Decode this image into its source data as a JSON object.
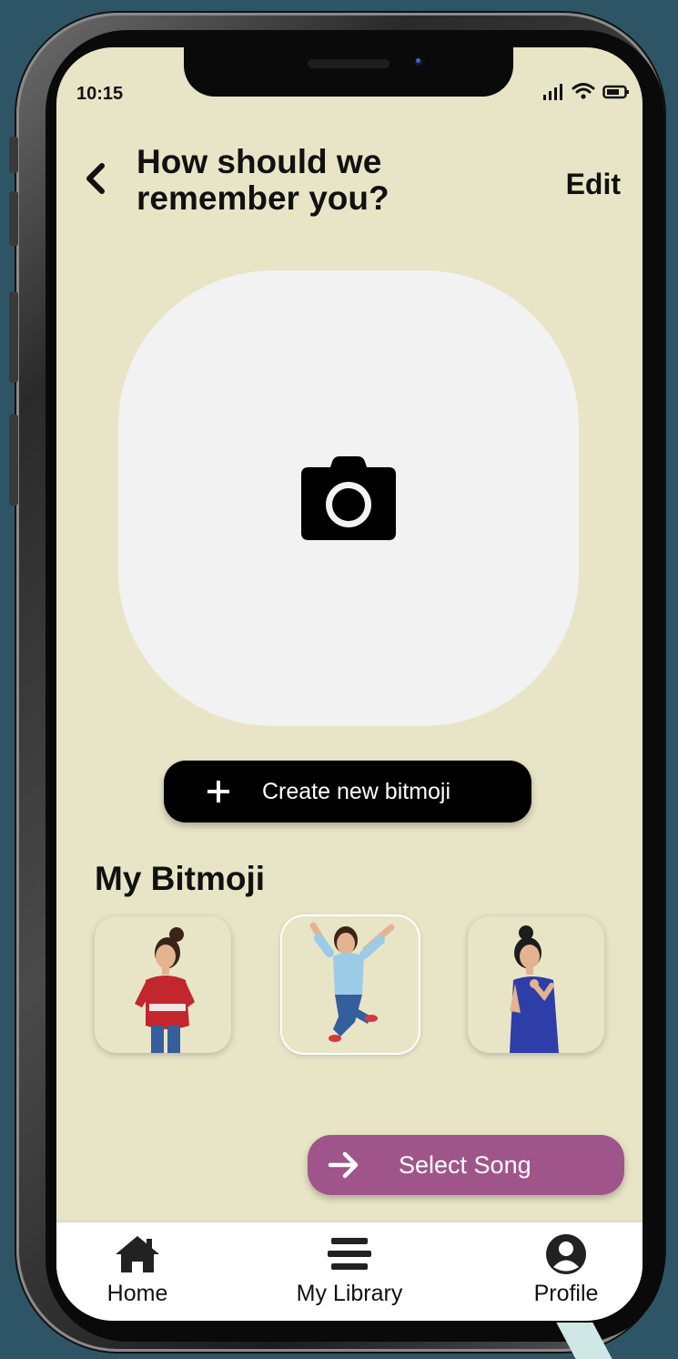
{
  "status": {
    "time": "10:15"
  },
  "header": {
    "title": "How should we remember you?",
    "edit_label": "Edit"
  },
  "photo": {
    "icon": "camera-icon"
  },
  "create_button": {
    "label": "Create new bitmoji"
  },
  "bitmoji": {
    "title": "My Bitmoji",
    "items": [
      {
        "name": "red-sweater-bitmoji",
        "selected": false
      },
      {
        "name": "jumping-bitmoji",
        "selected": true
      },
      {
        "name": "blue-dress-bitmoji",
        "selected": false
      }
    ]
  },
  "select_song": {
    "label": "Select Song"
  },
  "tabs": [
    {
      "label": "Home",
      "icon": "home-icon"
    },
    {
      "label": "My Library",
      "icon": "library-icon"
    },
    {
      "label": "Profile",
      "icon": "profile-icon"
    }
  ],
  "colors": {
    "screen_bg": "#e8e5c7",
    "accent": "#a0558a",
    "button_dark": "#000000",
    "device_bg": "#2d5566"
  }
}
